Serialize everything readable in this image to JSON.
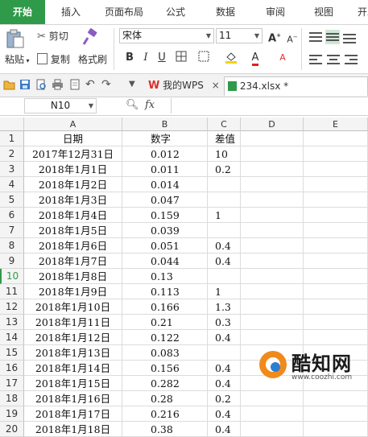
{
  "tabs": [
    "开始",
    "插入",
    "页面布局",
    "公式",
    "数据",
    "审阅",
    "视图",
    "开发"
  ],
  "ribbon": {
    "paste_label": "粘贴",
    "cut_label": "剪切",
    "copy_label": "复制",
    "format_painter_label": "格式刷",
    "font_name": "宋体",
    "font_size": "11",
    "bold": "B",
    "italic": "I",
    "underline": "U",
    "font_color_glyph": "A",
    "grow_font_glyph": "A",
    "shrink_font_glyph": "A",
    "clear_glyph": "A"
  },
  "quickbar": {
    "wps_tab_label": "我的WPS",
    "file_tab_label": "234.xlsx *",
    "close_glyph": "×"
  },
  "formula_bar": {
    "name_box": "N10",
    "fx_label": "fx",
    "value": ""
  },
  "sheet": {
    "columns": [
      "A",
      "B",
      "C",
      "D",
      "E"
    ],
    "selected_row": "10",
    "rows": [
      {
        "n": "1",
        "a": "日期",
        "b": "数字",
        "c": "差值"
      },
      {
        "n": "2",
        "a": "2017年12月31日",
        "b": "0.012",
        "c": "10"
      },
      {
        "n": "3",
        "a": "2018年1月1日",
        "b": "0.011",
        "c": "0.2"
      },
      {
        "n": "4",
        "a": "2018年1月2日",
        "b": "0.014",
        "c": ""
      },
      {
        "n": "5",
        "a": "2018年1月3日",
        "b": "0.047",
        "c": ""
      },
      {
        "n": "6",
        "a": "2018年1月4日",
        "b": "0.159",
        "c": "1"
      },
      {
        "n": "7",
        "a": "2018年1月5日",
        "b": "0.039",
        "c": ""
      },
      {
        "n": "8",
        "a": "2018年1月6日",
        "b": "0.051",
        "c": "0.4"
      },
      {
        "n": "9",
        "a": "2018年1月7日",
        "b": "0.044",
        "c": "0.4"
      },
      {
        "n": "10",
        "a": "2018年1月8日",
        "b": "0.13",
        "c": ""
      },
      {
        "n": "11",
        "a": "2018年1月9日",
        "b": "0.113",
        "c": "1"
      },
      {
        "n": "12",
        "a": "2018年1月10日",
        "b": "0.166",
        "c": "1.3"
      },
      {
        "n": "13",
        "a": "2018年1月11日",
        "b": "0.21",
        "c": "0.3"
      },
      {
        "n": "14",
        "a": "2018年1月12日",
        "b": "0.122",
        "c": "0.4"
      },
      {
        "n": "15",
        "a": "2018年1月13日",
        "b": "0.083",
        "c": ""
      },
      {
        "n": "16",
        "a": "2018年1月14日",
        "b": "0.156",
        "c": "0.4"
      },
      {
        "n": "17",
        "a": "2018年1月15日",
        "b": "0.282",
        "c": "0.4"
      },
      {
        "n": "18",
        "a": "2018年1月16日",
        "b": "0.28",
        "c": "0.2"
      },
      {
        "n": "19",
        "a": "2018年1月17日",
        "b": "0.216",
        "c": "0.4"
      },
      {
        "n": "20",
        "a": "2018年1月18日",
        "b": "0.38",
        "c": "0.4"
      }
    ]
  },
  "watermark": {
    "brand": "酷知网",
    "url": "www.coozhi.com"
  },
  "colors": {
    "accent": "#2f9a49",
    "header_bg": "#f4f4f4",
    "watermark_orange": "#f08a1c"
  }
}
